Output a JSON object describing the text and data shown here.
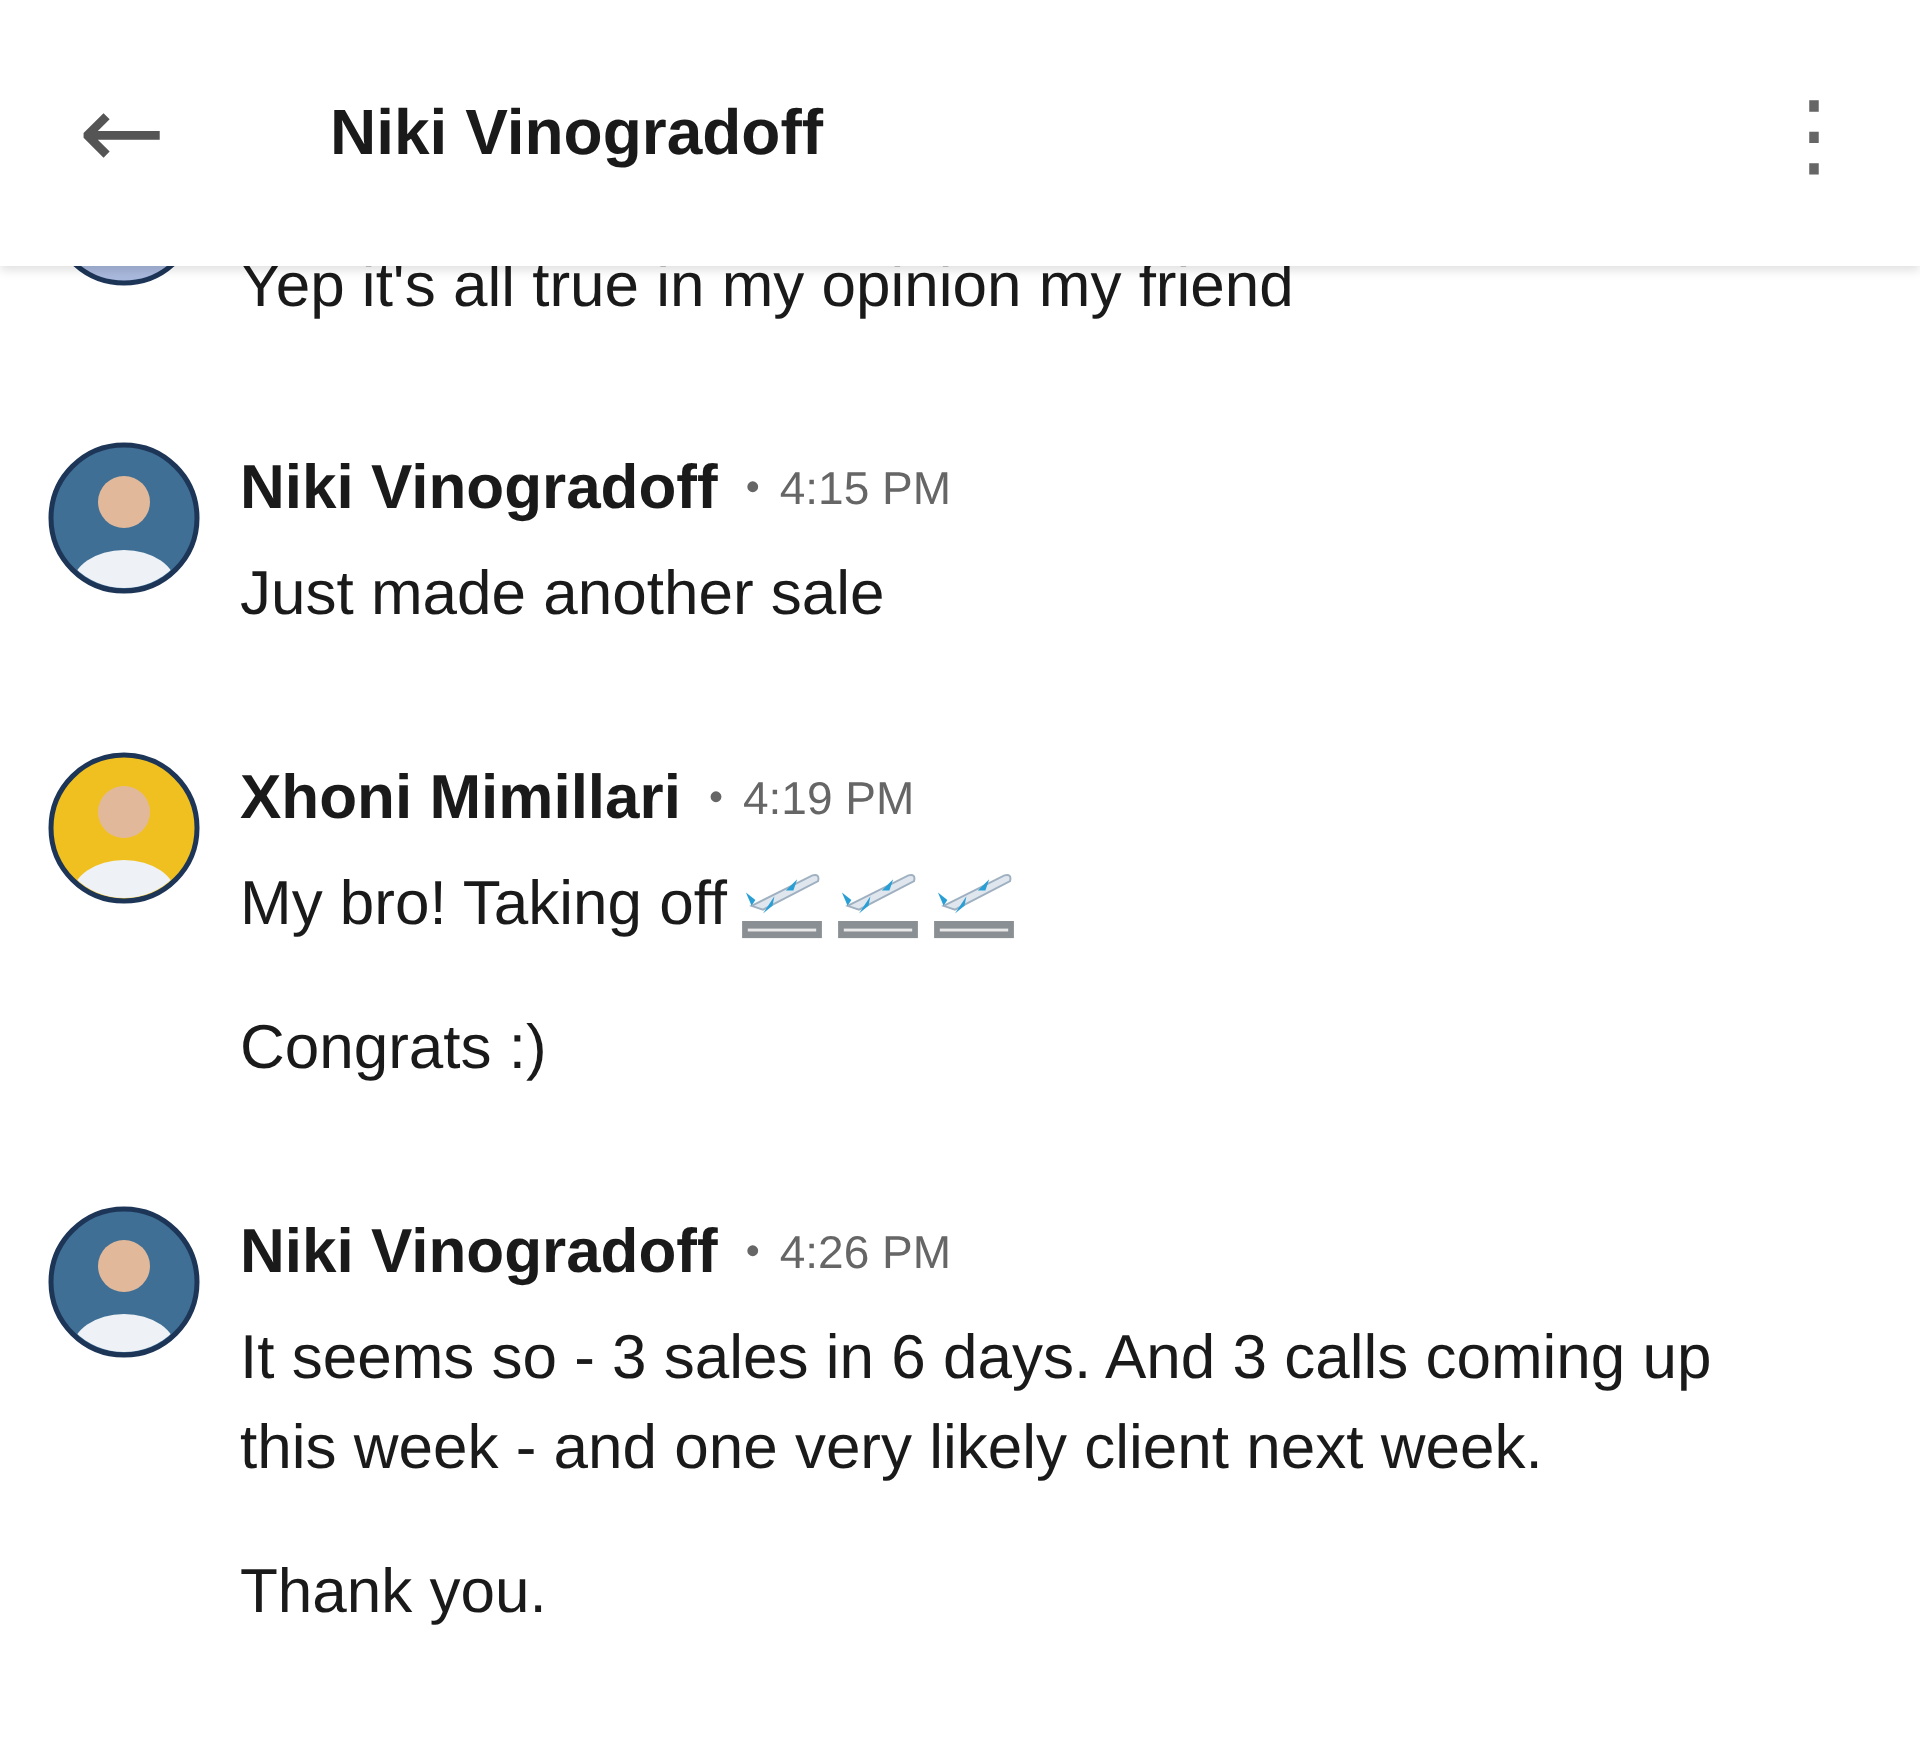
{
  "header": {
    "back": "←",
    "title": "Niki Vinogradoff",
    "menu": "⋮"
  },
  "groups": [
    {
      "avatar": {
        "color": "#a9b9dd"
      },
      "kind": "continuation",
      "messages": [
        {
          "text": "Yep it's all true in my opinion my friend"
        }
      ]
    },
    {
      "avatar": {
        "color": "#3f6f95"
      },
      "kind": "message",
      "author": "Niki Vinogradoff",
      "separator": "•",
      "time": "4:15 PM",
      "messages": [
        {
          "text": "Just made another sale"
        }
      ]
    },
    {
      "avatar": {
        "color": "#f0c020"
      },
      "kind": "message",
      "author": "Xhoni Mimillari",
      "separator": "•",
      "time": "4:19 PM",
      "messages": [
        {
          "text": "My bro! Taking off",
          "icons": [
            {
              "kind": "departure"
            },
            {
              "kind": "departure"
            },
            {
              "kind": "departure"
            }
          ]
        },
        {
          "text": "Congrats :)"
        }
      ]
    },
    {
      "avatar": {
        "color": "#3f6f95"
      },
      "kind": "message",
      "author": "Niki Vinogradoff",
      "separator": "•",
      "time": "4:26 PM",
      "messages": [
        {
          "text": "It seems so - 3 sales in 6 days. And 3 calls coming up this week - and one very likely client next week."
        },
        {
          "text": "Thank you."
        }
      ]
    }
  ]
}
